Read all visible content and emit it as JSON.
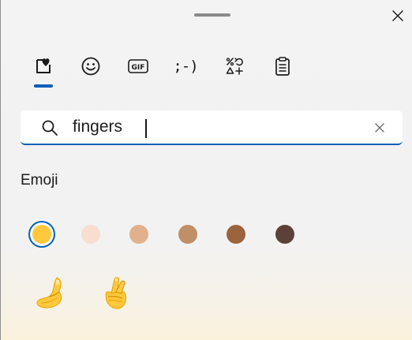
{
  "window": {
    "drag_handle": "drag-handle",
    "close_icon": "close-icon"
  },
  "tabs": [
    {
      "name": "tab-emoji",
      "icon": "heart-sticker-icon",
      "selected": true
    },
    {
      "name": "tab-kaomoji-smiley",
      "icon": "smiley-icon"
    },
    {
      "name": "tab-gif",
      "icon": "gif-icon",
      "label": "GIF"
    },
    {
      "name": "tab-kaomoji",
      "icon": "kaomoji-icon",
      "label": ";-)"
    },
    {
      "name": "tab-symbols",
      "icon": "symbols-icon"
    },
    {
      "name": "tab-clipboard",
      "icon": "clipboard-icon"
    }
  ],
  "search": {
    "value": "fingers",
    "icon": "search-icon",
    "clear_icon": "clear-icon"
  },
  "section": {
    "title": "Emoji"
  },
  "skin_tones": [
    {
      "color": "#ffc83d",
      "selected": true
    },
    {
      "color": "#f7dece"
    },
    {
      "color": "#e0b18c"
    },
    {
      "color": "#bf8f68"
    },
    {
      "color": "#9b643d"
    },
    {
      "color": "#5d4037"
    }
  ],
  "results": [
    {
      "name": "pinched-fingers-emoji",
      "icon": "pinched-fingers-icon"
    },
    {
      "name": "crossed-fingers-emoji",
      "icon": "crossed-fingers-icon"
    }
  ],
  "colors": {
    "accent": "#005fb8",
    "panel_bg": "#f3f3f3",
    "icon": "#1b1b1b"
  }
}
